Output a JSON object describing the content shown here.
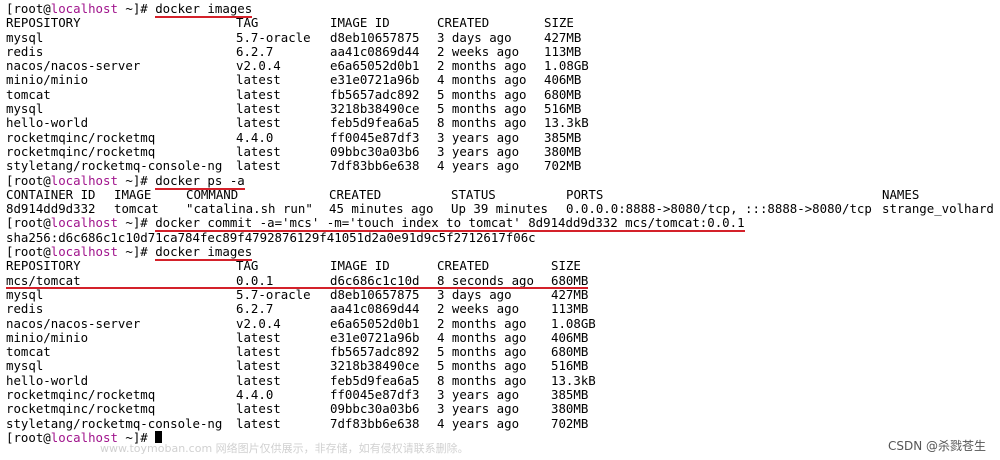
{
  "prompt": {
    "open": "[root@",
    "host": "localhost",
    "close": " ~]# "
  },
  "commands": {
    "images1": "docker images",
    "ps": "docker ps -a",
    "commit": "docker commit -a='mcs' -m='touch index to tomcat' 8d914dd9d332 mcs/tomcat:0.0.1",
    "images2": "docker images",
    "final": ""
  },
  "commit_output": "sha256:d6c686c1c10d71ca784fec89f4792876129f41051d2a0e91d9c5f2712617f06c",
  "images_headers": [
    "REPOSITORY",
    "TAG",
    "IMAGE ID",
    "CREATED",
    "SIZE"
  ],
  "images_before": [
    [
      "mysql",
      "5.7-oracle",
      "d8eb10657875",
      "3 days ago",
      "427MB"
    ],
    [
      "redis",
      "6.2.7",
      "aa41c0869d44",
      "2 weeks ago",
      "113MB"
    ],
    [
      "nacos/nacos-server",
      "v2.0.4",
      "e6a65052d0b1",
      "2 months ago",
      "1.08GB"
    ],
    [
      "minio/minio",
      "latest",
      "e31e0721a96b",
      "4 months ago",
      "406MB"
    ],
    [
      "tomcat",
      "latest",
      "fb5657adc892",
      "5 months ago",
      "680MB"
    ],
    [
      "mysql",
      "latest",
      "3218b38490ce",
      "5 months ago",
      "516MB"
    ],
    [
      "hello-world",
      "latest",
      "feb5d9fea6a5",
      "8 months ago",
      "13.3kB"
    ],
    [
      "rocketmqinc/rocketmq",
      "4.4.0",
      "ff0045e87df3",
      "3 years ago",
      "385MB"
    ],
    [
      "rocketmqinc/rocketmq",
      "latest",
      "09bbc30a03b6",
      "3 years ago",
      "380MB"
    ],
    [
      "styletang/rocketmq-console-ng",
      "latest",
      "7df83bb6e638",
      "4 years ago",
      "702MB"
    ]
  ],
  "ps_headers": [
    "CONTAINER ID",
    "IMAGE",
    "COMMAND",
    "CREATED",
    "STATUS",
    "PORTS",
    "NAMES"
  ],
  "ps_rows": [
    [
      "8d914dd9d332",
      "tomcat",
      "\"catalina.sh run\"",
      "45 minutes ago",
      "Up 39 minutes",
      "0.0.0.0:8888->8080/tcp, :::8888->8080/tcp",
      "strange_volhard"
    ]
  ],
  "images_after": [
    [
      "mcs/tomcat",
      "0.0.1",
      "d6c686c1c10d",
      "8 seconds ago",
      "680MB"
    ],
    [
      "mysql",
      "5.7-oracle",
      "d8eb10657875",
      "3 days ago",
      "427MB"
    ],
    [
      "redis",
      "6.2.7",
      "aa41c0869d44",
      "2 weeks ago",
      "113MB"
    ],
    [
      "nacos/nacos-server",
      "v2.0.4",
      "e6a65052d0b1",
      "2 months ago",
      "1.08GB"
    ],
    [
      "minio/minio",
      "latest",
      "e31e0721a96b",
      "4 months ago",
      "406MB"
    ],
    [
      "tomcat",
      "latest",
      "fb5657adc892",
      "5 months ago",
      "680MB"
    ],
    [
      "mysql",
      "latest",
      "3218b38490ce",
      "5 months ago",
      "516MB"
    ],
    [
      "hello-world",
      "latest",
      "feb5d9fea6a5",
      "8 months ago",
      "13.3kB"
    ],
    [
      "rocketmqinc/rocketmq",
      "4.4.0",
      "ff0045e87df3",
      "3 years ago",
      "385MB"
    ],
    [
      "rocketmqinc/rocketmq",
      "latest",
      "09bbc30a03b6",
      "3 years ago",
      "380MB"
    ],
    [
      "styletang/rocketmq-console-ng",
      "latest",
      "7df83bb6e638",
      "4 years ago",
      "702MB"
    ]
  ],
  "watermark": "CSDN @杀戮苍生",
  "overlay_text": "www.toymoban.com 网络图片仅供展示，非存储，如有侵权请联系删除。",
  "colors": {
    "host": "#a0148c",
    "underline": "#d4212a"
  }
}
